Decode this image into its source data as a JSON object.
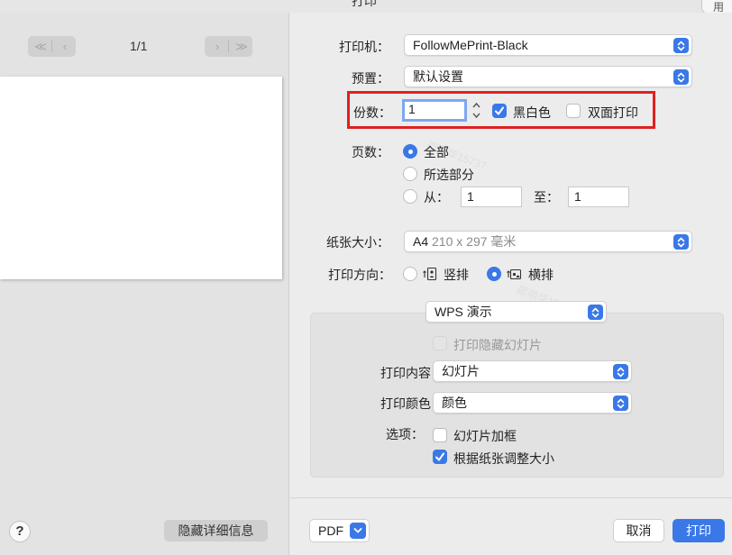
{
  "window": {
    "title": "打印",
    "corner_label": "用"
  },
  "preview": {
    "nav_first": "≪",
    "nav_prev": "‹",
    "nav_next": "›",
    "nav_last": "≫",
    "page_indicator": "1/1",
    "help_label": "?",
    "hide_details_label": "隐藏详细信息",
    "watermark": "邵丽华15737"
  },
  "printer": {
    "label": "打印机：",
    "value": "FollowMePrint-Black"
  },
  "presets": {
    "label": "预置：",
    "value": "默认设置"
  },
  "copies": {
    "label": "份数：",
    "value": "1",
    "black_white_label": "黑白色",
    "black_white_checked": true,
    "duplex_label": "双面打印",
    "duplex_checked": false
  },
  "pages": {
    "label": "页数：",
    "all_label": "全部",
    "selection_label": "所选部分",
    "from_label": "从：",
    "from_value": "1",
    "to_label": "至：",
    "to_value": "1",
    "selected": "all"
  },
  "paper_size": {
    "label": "纸张大小：",
    "value": "A4",
    "detail": "210 x 297 毫米"
  },
  "orientation": {
    "label": "打印方向：",
    "portrait_label": "竖排",
    "landscape_label": "横排",
    "selected": "landscape"
  },
  "app_options": {
    "app_popup": "WPS 演示",
    "print_hidden_slides_label": "打印隐藏幻灯片",
    "print_content_label": "打印内容：",
    "print_content_value": "幻灯片",
    "print_color_label": "打印颜色：",
    "print_color_value": "颜色",
    "options_label": "选项：",
    "frame_slides_label": "幻灯片加框",
    "frame_slides_checked": false,
    "scale_to_paper_label": "根据纸张调整大小",
    "scale_to_paper_checked": true
  },
  "footer": {
    "pdf_label": "PDF",
    "cancel_label": "取消",
    "print_label": "打印"
  },
  "colors": {
    "accent": "#3a78e7",
    "highlight": "#e02020"
  }
}
